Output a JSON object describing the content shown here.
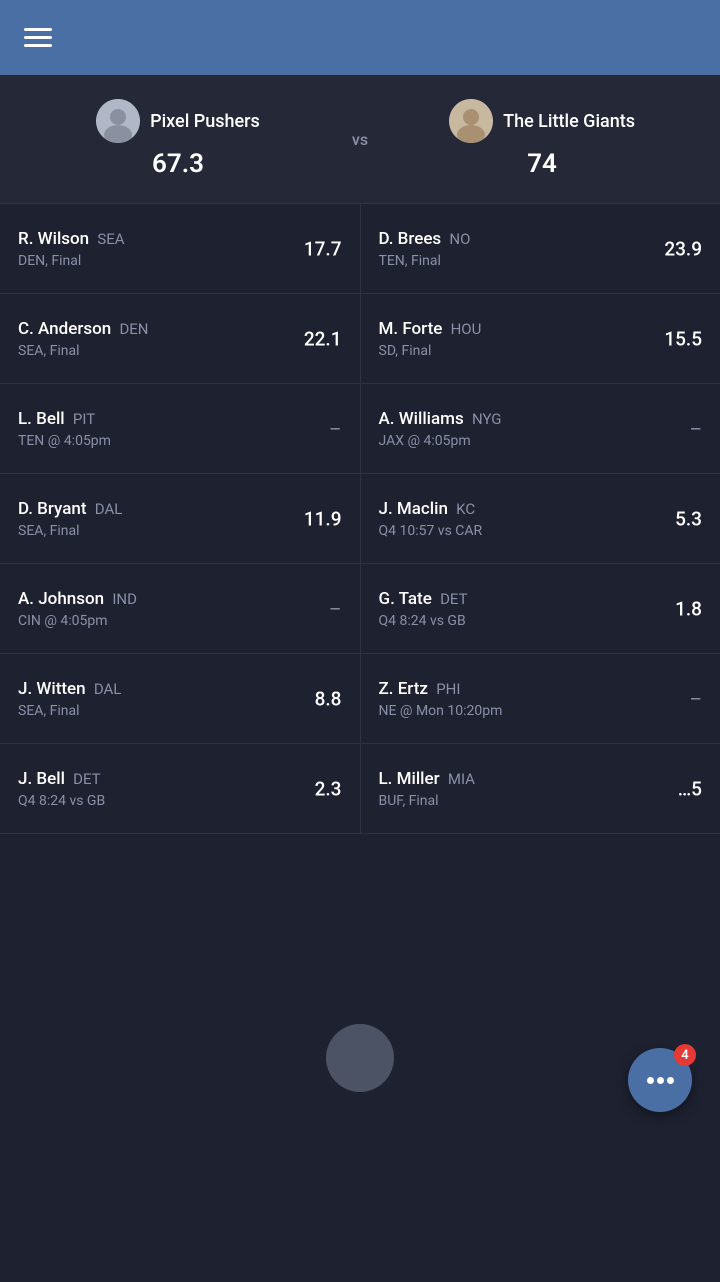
{
  "header": {
    "menu_icon": "hamburger-icon"
  },
  "matchup": {
    "team_left": {
      "name": "Pixel Pushers",
      "score": "67.3"
    },
    "vs": "vs",
    "team_right": {
      "name": "The Little Giants",
      "score": "74"
    }
  },
  "players": [
    {
      "left": {
        "name": "R. Wilson",
        "team": "SEA",
        "game": "DEN, Final",
        "score": "17.7"
      },
      "right": {
        "name": "D. Brees",
        "team": "NO",
        "game": "TEN, Final",
        "score": "23.9"
      }
    },
    {
      "left": {
        "name": "C. Anderson",
        "team": "DEN",
        "game": "SEA, Final",
        "score": "22.1"
      },
      "right": {
        "name": "M. Forte",
        "team": "HOU",
        "game": "SD, Final",
        "score": "15.5"
      }
    },
    {
      "left": {
        "name": "L. Bell",
        "team": "PIT",
        "game": "TEN @ 4:05pm",
        "score": "–"
      },
      "right": {
        "name": "A. Williams",
        "team": "NYG",
        "game": "JAX @ 4:05pm",
        "score": "–"
      }
    },
    {
      "left": {
        "name": "D. Bryant",
        "team": "DAL",
        "game": "SEA, Final",
        "score": "11.9"
      },
      "right": {
        "name": "J. Maclin",
        "team": "KC",
        "game": "Q4 10:57 vs CAR",
        "score": "5.3"
      }
    },
    {
      "left": {
        "name": "A. Johnson",
        "team": "IND",
        "game": "CIN @ 4:05pm",
        "score": "–"
      },
      "right": {
        "name": "G. Tate",
        "team": "DET",
        "game": "Q4 8:24 vs GB",
        "score": "1.8"
      }
    },
    {
      "left": {
        "name": "J. Witten",
        "team": "DAL",
        "game": "SEA, Final",
        "score": "8.8"
      },
      "right": {
        "name": "Z. Ertz",
        "team": "PHI",
        "game": "NE @ Mon 10:20pm",
        "score": "–"
      }
    },
    {
      "left": {
        "name": "J. Bell",
        "team": "DET",
        "game": "Q4 8:24 vs GB",
        "score": "2.3"
      },
      "right": {
        "name": "L. Miller",
        "team": "MIA",
        "game": "BUF, Final",
        "score": "…5"
      }
    }
  ],
  "chat": {
    "badge": "4"
  }
}
